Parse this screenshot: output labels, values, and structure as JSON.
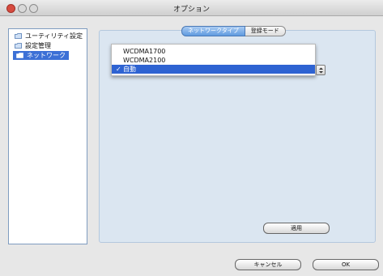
{
  "window": {
    "title": "オプション"
  },
  "sidebar": {
    "items": [
      {
        "label": "ユーティリティ設定",
        "selected": false
      },
      {
        "label": "設定管理",
        "selected": false
      },
      {
        "label": "ネットワーク",
        "selected": true
      }
    ]
  },
  "tabs": [
    {
      "label": "ネットワークタイプ",
      "selected": true
    },
    {
      "label": "登録モード",
      "selected": false
    }
  ],
  "network_type_select": {
    "options": [
      "WCDMA1700",
      "WCDMA2100",
      "自動"
    ],
    "selected": "自動",
    "checkmark": "✓"
  },
  "buttons": {
    "apply": "適用",
    "cancel": "キャンセル",
    "ok": "OK"
  },
  "colors": {
    "accent": "#2e63d2",
    "panel_bg": "#dbe6f1",
    "close_button": "#d64b3f"
  }
}
